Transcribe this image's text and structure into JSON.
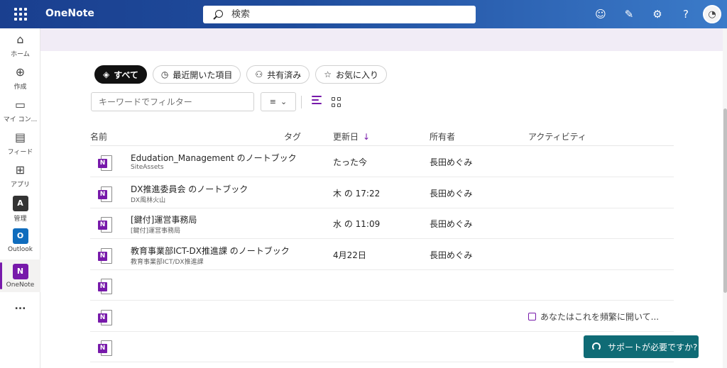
{
  "topbar": {
    "app_name": "OneNote",
    "search_placeholder": "検索",
    "icons": [
      "waffle-icon",
      "smiley-icon",
      "feedback-icon",
      "settings-gear-icon",
      "help-icon",
      "avatar"
    ]
  },
  "rail": {
    "items": [
      {
        "label": "ホーム",
        "icon": "home-icon"
      },
      {
        "label": "作成",
        "icon": "create-plus-icon"
      },
      {
        "label": "マイ コン...",
        "icon": "folder-icon"
      },
      {
        "label": "フィード",
        "icon": "feed-icon"
      },
      {
        "label": "アプリ",
        "icon": "apps-icon"
      },
      {
        "label": "管理",
        "icon": "admin-icon",
        "badge": "A"
      },
      {
        "label": "Outlook",
        "icon": "outlook-icon",
        "badge": "O"
      },
      {
        "label": "OneNote",
        "icon": "onenote-icon",
        "badge": "N"
      }
    ],
    "more": "..."
  },
  "tabs": [
    {
      "label": "すべて",
      "icon": "cube-icon",
      "selected": true
    },
    {
      "label": "最近開いた項目",
      "icon": "clock-icon"
    },
    {
      "label": "共有済み",
      "icon": "people-icon"
    },
    {
      "label": "お気に入り",
      "icon": "star-icon"
    }
  ],
  "filter": {
    "placeholder": "キーワードでフィルター",
    "sort_icon": "filter-lines-icon"
  },
  "table": {
    "headers": {
      "name": "名前",
      "tag": "タグ",
      "updated": "更新日",
      "owner": "所有者",
      "activity": "アクティビティ"
    },
    "rows": [
      {
        "name": "Edudation_Management のノートブック",
        "sub": "SiteAssets",
        "updated": "たった今",
        "owner": "長田めぐみ",
        "activity": ""
      },
      {
        "name": "DX推進委員会 のノートブック",
        "sub": "DX風林火山",
        "updated": "木 の 17:22",
        "owner": "長田めぐみ",
        "activity": ""
      },
      {
        "name": "[鍵付]運営事務局",
        "sub": "[鍵付]運営事務局",
        "updated": "水 の 11:09",
        "owner": "長田めぐみ",
        "activity": ""
      },
      {
        "name": "教育事業部ICT-DX推進課 のノートブック",
        "sub": "教育事業部ICT/DX推進課",
        "updated": "4月22日",
        "owner": "長田めぐみ",
        "activity": ""
      },
      {
        "name": "",
        "sub": "",
        "updated": "",
        "owner": "",
        "activity": "",
        "blurred": true
      },
      {
        "name": "",
        "sub": "",
        "updated": "",
        "owner": "",
        "activity": "あなたはこれを頻繁に開いて...",
        "blurred": true
      },
      {
        "name": "",
        "sub": "",
        "updated": "",
        "owner": "",
        "activity": "",
        "blurred": true
      }
    ]
  },
  "support_button": "サポートが必要ですか?",
  "colors": {
    "accent": "#7719aa",
    "topbar": "#1f4c9c",
    "support": "#0f6b75"
  }
}
